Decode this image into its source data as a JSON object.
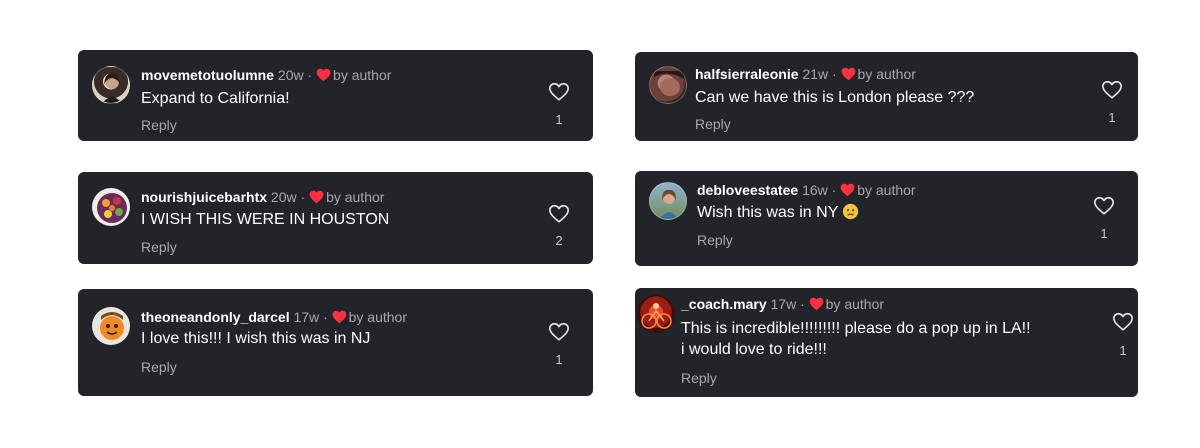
{
  "by_author": "by author",
  "reply_label": "Reply",
  "comments": [
    {
      "username": "movemetotuolumne",
      "time": "20w",
      "text": "Expand to California!",
      "likes": "1",
      "avatar": "woman-portrait-avatar"
    },
    {
      "username": "halfsierraleonie",
      "time": "21w",
      "text": "Can we have this is London please ???",
      "likes": "1",
      "avatar": "woman-closeup-avatar"
    },
    {
      "username": "nourishjuicebarhtx",
      "time": "20w",
      "text": "I WISH THIS WERE IN HOUSTON",
      "likes": "2",
      "avatar": "fruit-logo-avatar"
    },
    {
      "username": "debloveestatee",
      "time": "16w",
      "text": "Wish this was in NY",
      "emoji": "crying-face-emoji",
      "likes": "1",
      "avatar": "woman-outdoor-avatar"
    },
    {
      "username": "theoneandonly_darcel",
      "time": "17w",
      "text": "I love this!!! I wish this was in NJ",
      "likes": "1",
      "avatar": "orange-cartoon-avatar"
    },
    {
      "username": "_coach.mary",
      "time": "17w",
      "text": "This is incredible!!!!!!!!! please do a pop up in LA!!",
      "text2": "i would love to ride!!!",
      "likes": "1",
      "avatar": "red-cycling-avatar"
    }
  ],
  "colors": {
    "card_bg": "#232429",
    "heart_red": "#ff3040",
    "muted_text": "#a7a8ad"
  }
}
